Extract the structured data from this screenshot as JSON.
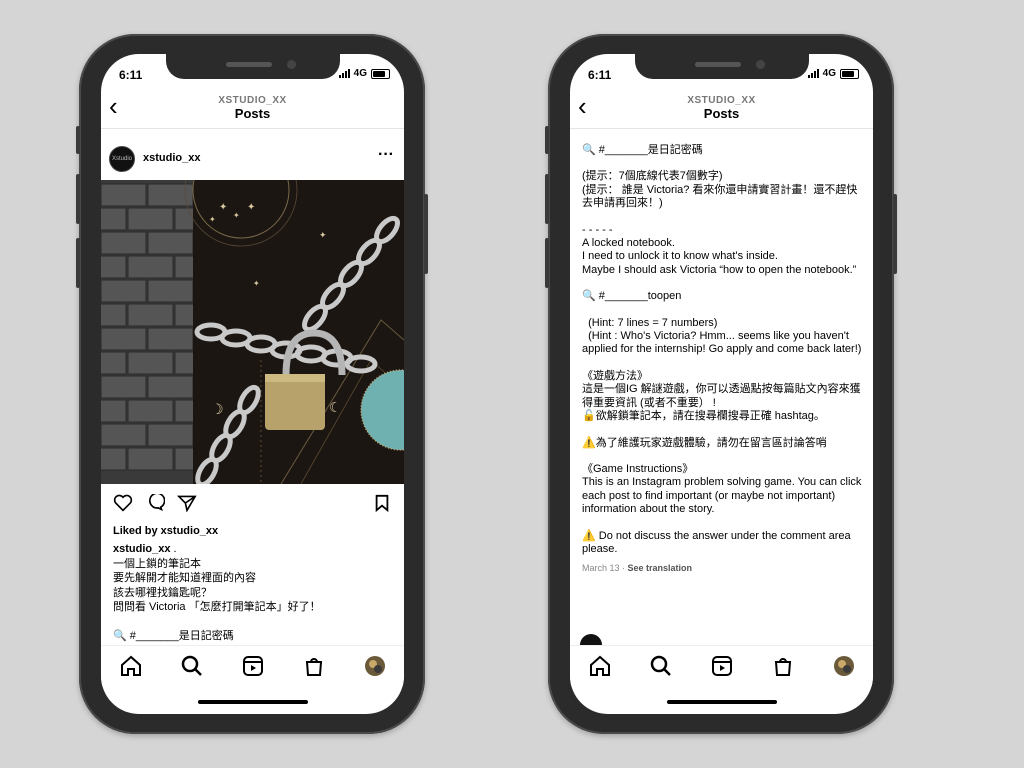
{
  "status": {
    "time": "6:11",
    "network": "4G"
  },
  "header": {
    "username": "XSTUDIO_XX",
    "title": "Posts"
  },
  "post": {
    "username": "xstudio_xx",
    "logo_text": "Xstudio",
    "liked_by": "Liked by xstudio_xx",
    "caption_user": "xstudio_xx",
    "caption_lines": [
      ".",
      "一個上鎖的筆記本",
      "要先解開才能知道裡面的內容",
      "該去哪裡找鑰匙呢？",
      "問問看 Victoria 「怎麼打開筆記本」好了！",
      "",
      "🔍 #_______是日記密碼"
    ]
  },
  "detail": {
    "lines": [
      "🔍 #_______是日記密碼",
      "",
      "(提示：7個底線代表7個數字)",
      "(提示： 誰是 Victoria? 看來你還申請實習計畫！還不趕快去申請再回來！)",
      "",
      "- - - - -",
      "A locked notebook.",
      "I need to unlock it to know what's inside.",
      "Maybe I should ask Victoria “how to open the notebook.”",
      "",
      "🔍 #_______toopen",
      "",
      "  (Hint: 7 lines = 7 numbers)",
      "  (Hint : Who's Victoria? Hmm... seems like you haven't applied for the internship! Go apply and come back later!)",
      "",
      "《遊戲方法》",
      "這是一個IG 解謎遊戲，你可以透過點按每篇貼文內容來獲得重要資訊 (或者不重要） !",
      "🔓欲解鎖筆記本，請在搜尋欄搜尋正確 hashtag。",
      "",
      "⚠️為了維護玩家遊戲體驗，請勿在留言區討論答哨",
      "",
      "《Game Instructions》",
      "This is an Instagram problem solving game. You can click each post to find important (or maybe not important) information about the story.",
      "",
      "⚠️ Do not discuss the answer under the comment area please."
    ],
    "date": "March 13",
    "see_translation": "See translation"
  }
}
